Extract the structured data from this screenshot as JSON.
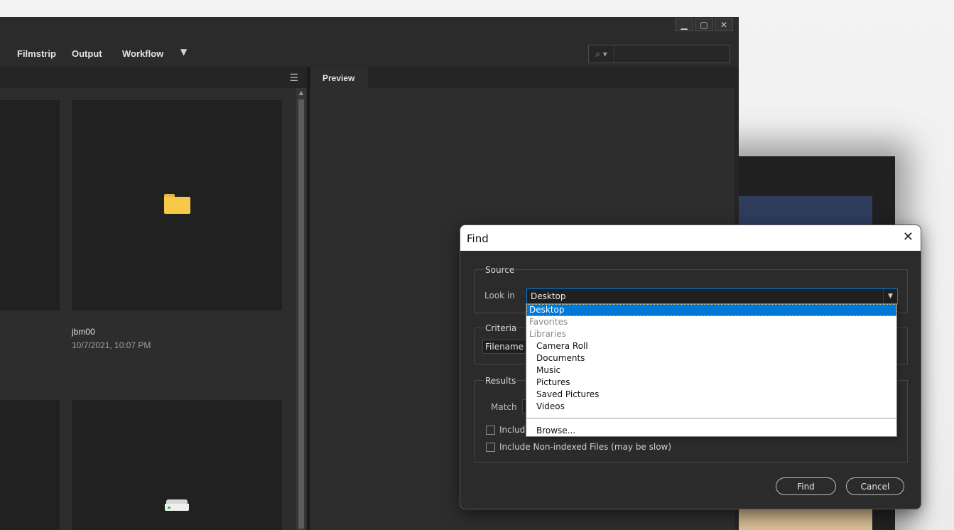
{
  "app": {
    "window_controls": {
      "minimize": "▁",
      "maximize": "▢",
      "close": "✕"
    },
    "menu": {
      "filmstrip": "Filmstrip",
      "output": "Output",
      "workflow": "Workflow",
      "more": "▼"
    },
    "search": {
      "icon": "search-icon",
      "placeholder": ""
    },
    "content": {
      "items": [
        {
          "name": "jbm00",
          "date": "10/7/2021, 10:07 PM",
          "icon": "folder-icon"
        },
        {
          "name": "",
          "date": "",
          "icon": "drive-icon"
        }
      ]
    },
    "preview": {
      "tab_label": "Preview"
    }
  },
  "find_dialog": {
    "title": "Find",
    "close": "✕",
    "source": {
      "group_label": "Source",
      "look_in_label": "Look in",
      "look_in_value": "Desktop"
    },
    "criteria": {
      "group_label": "Criteria",
      "field_value": "Filename"
    },
    "results": {
      "group_label": "Results",
      "match_label": "Match",
      "include_label_partial": "Include",
      "non_indexed_label": "Include Non-indexed Files (may be slow)"
    },
    "buttons": {
      "find": "Find",
      "cancel": "Cancel"
    },
    "dropdown_options": [
      {
        "label": "Desktop",
        "kind": "top",
        "selected": true
      },
      {
        "label": "Favorites",
        "kind": "header",
        "selected": false
      },
      {
        "label": "Libraries",
        "kind": "header",
        "selected": false
      },
      {
        "label": "Camera Roll",
        "kind": "item",
        "selected": false
      },
      {
        "label": "Documents",
        "kind": "item",
        "selected": false
      },
      {
        "label": "Music",
        "kind": "item",
        "selected": false
      },
      {
        "label": "Pictures",
        "kind": "item",
        "selected": false
      },
      {
        "label": "Saved Pictures",
        "kind": "item",
        "selected": false
      },
      {
        "label": "Videos",
        "kind": "item",
        "selected": false
      },
      {
        "label": "Browse...",
        "kind": "item",
        "selected": false
      }
    ]
  },
  "colors": {
    "selection": "#0078d7",
    "app_bg": "#252525",
    "panel_bg": "#2d2d2d",
    "folder": "#f7c948"
  }
}
